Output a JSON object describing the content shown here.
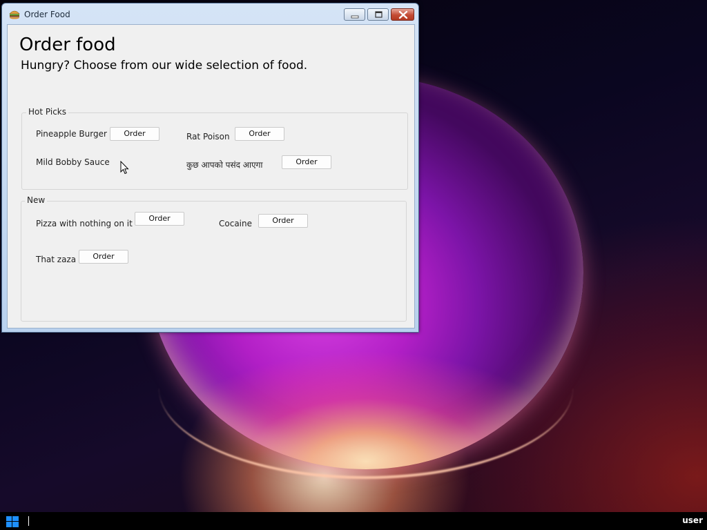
{
  "window": {
    "title": "Order Food",
    "app_icon": "burger-icon",
    "controls": [
      "minimize-icon",
      "maximize-icon",
      "close-icon"
    ]
  },
  "page": {
    "heading": "Order food",
    "subheading": "Hungry? Choose from our wide selection of food."
  },
  "groups": [
    {
      "label": "Hot Picks",
      "items": [
        {
          "name": "Pineapple Burger",
          "button": "Order"
        },
        {
          "name": "Rat Poison",
          "button": "Order"
        },
        {
          "name": "Mild Bobby Sauce",
          "button": null
        },
        {
          "name": "कुछ आपको पसंद आएगा",
          "button": "Order"
        }
      ]
    },
    {
      "label": "New",
      "items": [
        {
          "name": "Pizza with nothing on it",
          "button": "Order"
        },
        {
          "name": "Cocaine",
          "button": "Order"
        },
        {
          "name": "That zaza",
          "button": "Order"
        }
      ]
    }
  ],
  "taskbar": {
    "start_icon": "windows-logo-icon",
    "user": "user"
  },
  "colors": {
    "window_frame": "#b9d1ee",
    "client_bg": "#f0f0f0",
    "close_button": "#c44b34",
    "taskbar": "#000000"
  }
}
